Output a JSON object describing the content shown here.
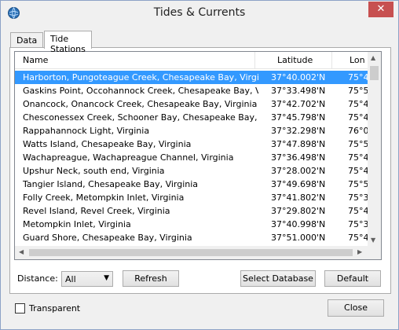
{
  "window": {
    "title": "Tides & Currents",
    "close_glyph": "✕"
  },
  "tabs": [
    {
      "label": "Data"
    },
    {
      "label": "Tide Stations"
    }
  ],
  "table": {
    "columns": [
      "Name",
      "Latitude",
      "Lon"
    ],
    "rows": [
      {
        "name": "Harborton, Pungoteague Creek, Chesapeake Bay, Virginia",
        "lat": "37°40.002'N",
        "lon": "75°4"
      },
      {
        "name": "Gaskins Point, Occohannock Creek, Chesapeake Bay, Virginia",
        "lat": "37°33.498'N",
        "lon": "75°5"
      },
      {
        "name": "Onancock, Onancock Creek, Chesapeake Bay, Virginia",
        "lat": "37°42.702'N",
        "lon": "75°4"
      },
      {
        "name": "Chesconessex Creek, Schooner Bay, Chesapeake Bay, Virginia",
        "lat": "37°45.798'N",
        "lon": "75°4"
      },
      {
        "name": "Rappahannock Light, Virginia",
        "lat": "37°32.298'N",
        "lon": "76°0"
      },
      {
        "name": "Watts Island, Chesapeake Bay, Virginia",
        "lat": "37°47.898'N",
        "lon": "75°5"
      },
      {
        "name": "Wachapreague, Wachapreague Channel, Virginia",
        "lat": "37°36.498'N",
        "lon": "75°4"
      },
      {
        "name": "Upshur Neck, south end, Virginia",
        "lat": "37°28.002'N",
        "lon": "75°4"
      },
      {
        "name": "Tangier Island, Chesapeake Bay, Virginia",
        "lat": "37°49.698'N",
        "lon": "75°5"
      },
      {
        "name": "Folly Creek, Metompkin Inlet, Virginia",
        "lat": "37°41.802'N",
        "lon": "75°3"
      },
      {
        "name": "Revel Island, Revel Creek, Virginia",
        "lat": "37°29.802'N",
        "lon": "75°4"
      },
      {
        "name": "Metompkin Inlet, Virginia",
        "lat": "37°40.998'N",
        "lon": "75°3"
      },
      {
        "name": "Guard Shore, Chesapeake Bay, Virginia",
        "lat": "37°51.000'N",
        "lon": "75°4"
      }
    ]
  },
  "controls": {
    "distance_label": "Distance:",
    "distance_value": "All",
    "refresh": "Refresh",
    "select_database": "Select Database",
    "default": "Default",
    "transparent_label": "Transparent",
    "close": "Close"
  },
  "scroll": {
    "up": "▲",
    "down": "▼",
    "left": "◀",
    "right": "▶",
    "dropdown": "▼"
  }
}
